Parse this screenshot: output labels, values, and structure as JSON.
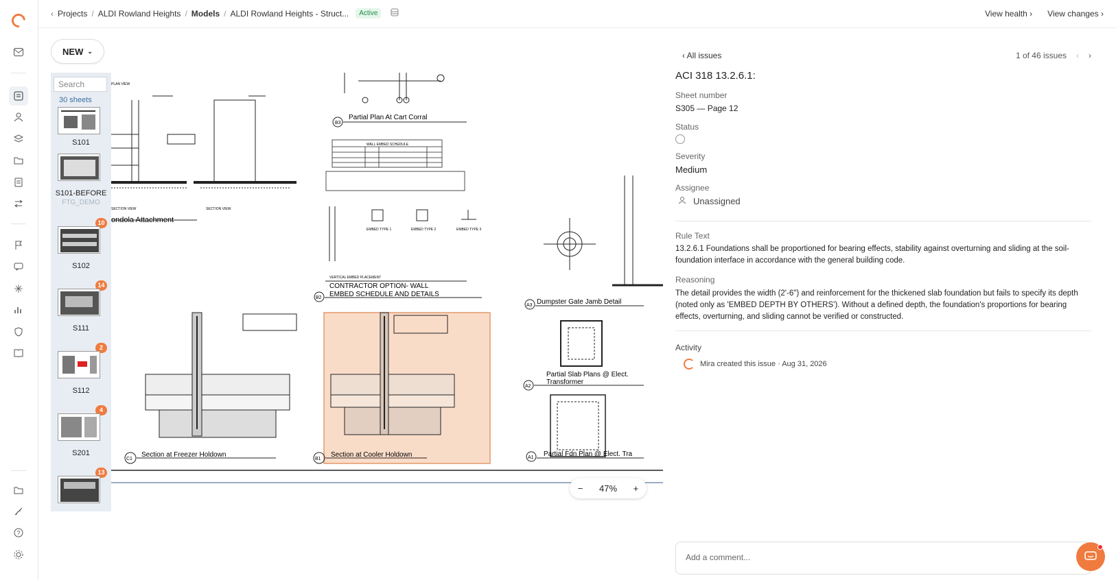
{
  "breadcrumb": {
    "projects": "Projects",
    "project": "ALDI Rowland Heights",
    "models": "Models",
    "model": "ALDI Rowland Heights - Struct...",
    "status": "Active"
  },
  "top_actions": {
    "view_health": "View health",
    "view_changes": "View changes"
  },
  "new_button": "NEW",
  "sheets": {
    "search_placeholder": "Search",
    "count": "30 sheets",
    "items": [
      {
        "label": "S101",
        "sub": "",
        "count": ""
      },
      {
        "label": "S101-BEFORE",
        "sub": "FTG_DEMO",
        "count": ""
      },
      {
        "label": "S102",
        "sub": "",
        "count": "10"
      },
      {
        "label": "S111",
        "sub": "",
        "count": "14"
      },
      {
        "label": "S112",
        "sub": "",
        "count": "2"
      },
      {
        "label": "S201",
        "sub": "",
        "count": "4"
      },
      {
        "label": "",
        "sub": "",
        "count": "13"
      }
    ]
  },
  "drawing": {
    "labels": {
      "b3": "B3",
      "b3_title": "Partial Plan At Cart Corral",
      "gondola": "ondola Attachment",
      "b2": "B2",
      "b2_title1": "CONTRACTOR OPTION- WALL",
      "b2_title2": "EMBED SCHEDULE AND DETAILS",
      "a3": "A3",
      "a3_title": "Dumpster Gate Jamb Detail",
      "a2": "A2",
      "a2_title1": "Partial Slab Plans @ Elect.",
      "a2_title2": "Transformer",
      "a1": "A1",
      "a1_title": "Partial Fdn Plan @ Elect. Tra",
      "c1": "C1",
      "c1_title": "Section at Freezer Holdown",
      "b1": "B1",
      "b1_title": "Section at Cooler Holdown",
      "wall_embed": "WALL EMBED SCHEDULE",
      "plan_view": "PLAN VIEW",
      "section_view": "SECTION VIEW",
      "vertical_embed": "VERTICAL EMBED PLACEMENT",
      "embed_type_1": "EMBED TYPE 1",
      "embed_type_2": "EMBED TYPE 2",
      "embed_type_3": "EMBED TYPE 3"
    }
  },
  "zoom": {
    "minus": "−",
    "level": "47%",
    "plus": "+"
  },
  "issue": {
    "all_issues": "All issues",
    "position": "1 of 46 issues",
    "title": "ACI 318 13.2.6.1:",
    "sheet_number_label": "Sheet number",
    "sheet_number": "S305 — Page 12",
    "status_label": "Status",
    "severity_label": "Severity",
    "severity": "Medium",
    "assignee_label": "Assignee",
    "assignee": "Unassigned",
    "rule_text_label": "Rule Text",
    "rule_text": "13.2.6.1 Foundations shall be proportioned for bearing effects, stability against overturning and sliding at the soil-foundation interface in accordance with the general building code.",
    "reasoning_label": "Reasoning",
    "reasoning": "The detail provides the width (2'-6\") and reinforcement for the thickened slab foundation but fails to specify its depth (noted only as 'EMBED DEPTH BY OTHERS'). Without a defined depth, the foundation's proportions for bearing effects, overturning, and sliding cannot be verified or constructed.",
    "activity_label": "Activity",
    "activity_entry": "Mira created this issue · Aug 31, 2026",
    "comment_placeholder": "Add a comment..."
  },
  "colors": {
    "accent": "#f07b3f",
    "highlight": "#f9dcc8",
    "active_badge": "#1f8a4c"
  }
}
